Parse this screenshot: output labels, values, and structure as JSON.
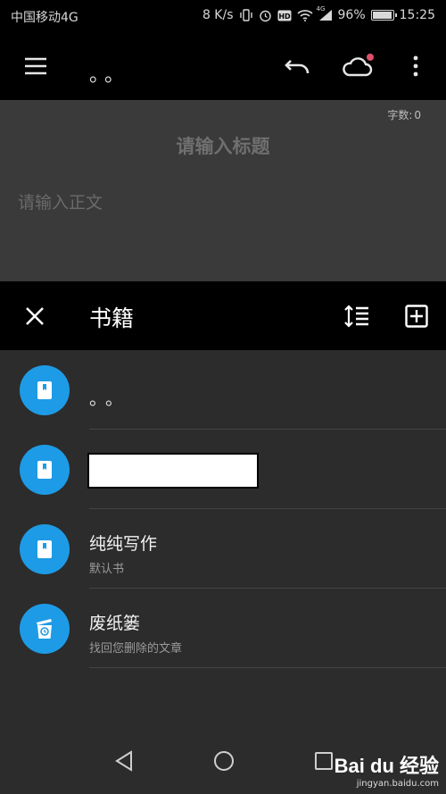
{
  "status_bar": {
    "carrier": "中国移动4G",
    "speed": "8 K/s",
    "network": "4G",
    "battery": "96%",
    "battery_level": 0.96,
    "time": "15:25"
  },
  "app_bar": {
    "title": "。。"
  },
  "editor": {
    "word_count_label": "字数:",
    "word_count": "0",
    "title_placeholder": "请输入标题",
    "body_placeholder": "请输入正文"
  },
  "books_panel": {
    "title": "书籍",
    "items": [
      {
        "name": "。。",
        "subtitle": "",
        "icon": "book-icon"
      },
      {
        "name": "",
        "subtitle": "",
        "icon": "book-icon"
      },
      {
        "name": "纯纯写作",
        "subtitle": "默认书",
        "icon": "book-icon"
      },
      {
        "name": "废纸篓",
        "subtitle": "找回您删除的文章",
        "icon": "trash-restore-icon"
      }
    ]
  },
  "watermark": {
    "main": "Bai du 经验",
    "sub": "jingyan.baidu.com"
  },
  "colors": {
    "accent": "#1e9be6",
    "app_bar": "#000000",
    "background": "#2c2c2c",
    "editor_bg": "#3a3a3a",
    "notification_dot": "#e0506a"
  }
}
